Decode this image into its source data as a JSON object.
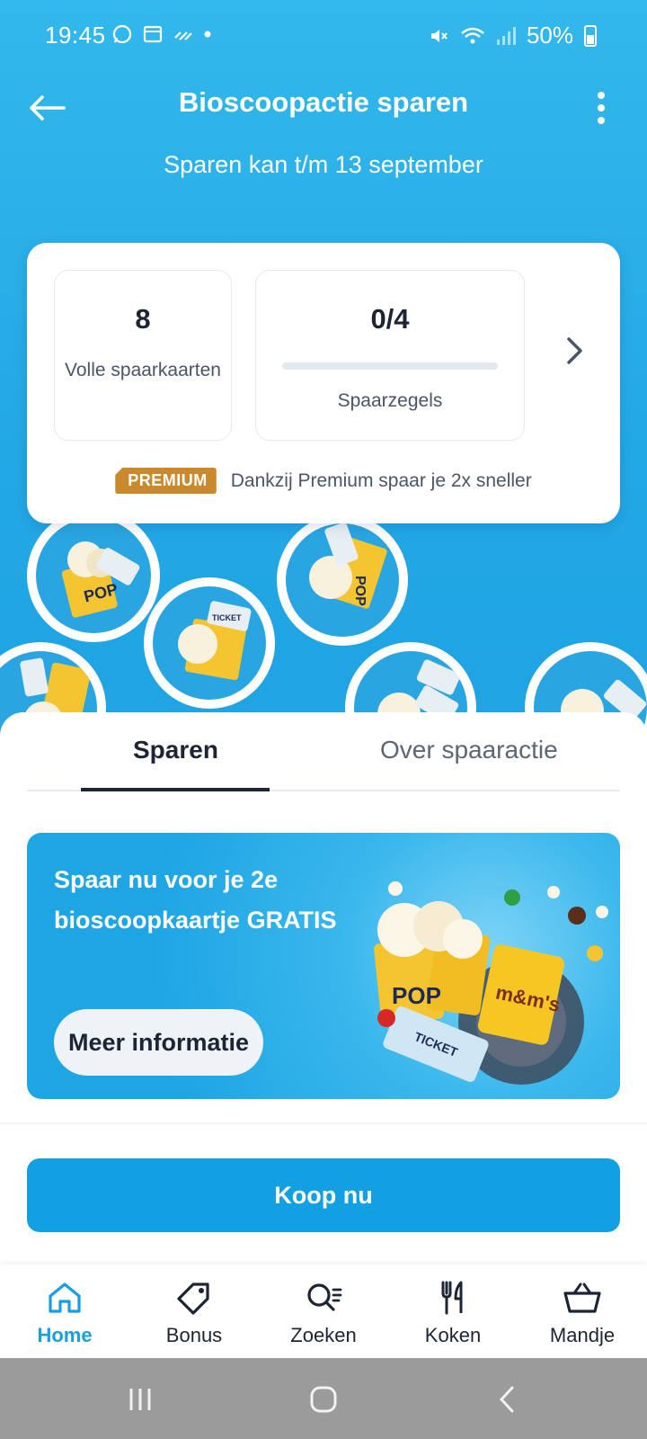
{
  "status_bar": {
    "time": "19:45",
    "battery": "50%"
  },
  "header": {
    "title": "Bioscoopactie sparen",
    "subtitle": "Sparen kan t/m 13 september"
  },
  "stats": {
    "full_cards_value": "8",
    "full_cards_label": "Volle spaarkaarten",
    "stamps_value": "0/4",
    "stamps_progress": 0,
    "stamps_label": "Spaarzegels",
    "premium_badge": "PREMIUM",
    "premium_text": "Dankzij Premium spaar je 2x sneller"
  },
  "stamp_graphic": {
    "word": "Bioscoopzegel",
    "label_pop": "POP",
    "label_ticket": "TICKET"
  },
  "tabs": [
    {
      "label": "Sparen",
      "active": true
    },
    {
      "label": "Over spaaractie",
      "active": false
    }
  ],
  "promo": {
    "text": "Spaar nu voor je 2e bioscoopkaartje GRATIS",
    "button": "Meer informatie",
    "pop_label": "POP",
    "ticket_label": "TICKET",
    "mm_label": "m&m's"
  },
  "buy_button": "Koop nu",
  "bottom_nav": [
    {
      "label": "Home",
      "icon": "home-icon",
      "active": true
    },
    {
      "label": "Bonus",
      "icon": "tag-icon",
      "active": false
    },
    {
      "label": "Zoeken",
      "icon": "search-list-icon",
      "active": false
    },
    {
      "label": "Koken",
      "icon": "cutlery-icon",
      "active": false
    },
    {
      "label": "Mandje",
      "icon": "basket-icon",
      "active": false
    }
  ],
  "colors": {
    "brand_blue": "#179fdf",
    "premium_gold": "#c9892c",
    "text_dark": "#1d2433"
  }
}
